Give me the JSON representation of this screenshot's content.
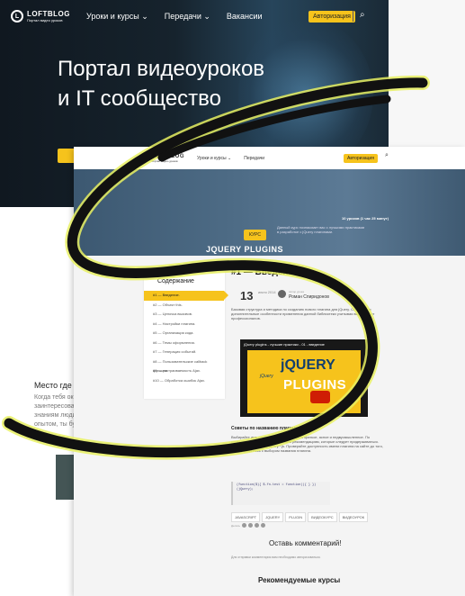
{
  "back": {
    "logo": {
      "name": "LOFTBLOG",
      "tagline": "Портал видео уроков",
      "mark": "L"
    },
    "nav": [
      "Уроки и курсы",
      "Передачи",
      "Вакансии"
    ],
    "auth_label": "Авторизация",
    "hero_title": "Портал видеоуроков и IT сообщество",
    "side_heading": "Место где",
    "side_text": "Когда тебя ок заинтересова знаниям люди опытом, ты бу"
  },
  "front": {
    "logo": {
      "name": "LOFTBLOG",
      "tagline": "Портал видео уроков",
      "mark": "L"
    },
    "nav": [
      "Уроки и курсы",
      "Передачи"
    ],
    "auth_label": "Авторизация",
    "badge": "КУРС",
    "course_title": "JQUERY PLUGINS",
    "meta": "10 уроков (1 час 25 минут)",
    "banner_desc": "Данный курс познакомит вас с лучшими практиками в разработке с jQuery плагинами.",
    "toc_heading": "Содержание",
    "toc": [
      "#1 — Введение.",
      "#2 — Объект this.",
      "#3 — Цепочка вызовов.",
      "#4 — Настройки плагина.",
      "#5 — Организация кода.",
      "#6 — Темы оформления.",
      "#7 — Генерация событий.",
      "#8 — Пользовательские callback функции.",
      "#9 — настраиваемость Ajax.",
      "#10 — Обработка ошибок Ajax."
    ],
    "article": {
      "title": "#1 — Введение.",
      "date_day": "13",
      "date_month": "июля 2014",
      "author_label": "Автор урока",
      "author": "Роман Спиридонов",
      "intro": "Базовая структура и методика по созданию нового плагина для jQuery. Основные и дополнительные особенности применения данной библиотеки учитывая вариации от профессионалов.",
      "video_title": "jQuery plugins - лучшие практики - 01 - введение",
      "video_logo": "jQUERY",
      "video_logo2": "PLUGINS",
      "video_small": "jQuery",
      "subheading": "Советы по названию плагина",
      "body": "Выбирайте имя плагина. Имя должно быть краткое, ясное и недвусмысленное. По соглашению необходимо следовать рекомендациям, которые следует придерживаться. Используйте префикс jquery.*.js. Проверяйте доступность имени плагина на сайте до того, как определитесь с выбором названия плагина.",
      "code": "(function($){ $.fn.test = function(){ } })(jQuery);",
      "tags": [
        "JAVASCRIPT",
        "JQUERY",
        "PLUGIN",
        "ВИДЕОКУРС",
        "ВИДЕОУРОК"
      ],
      "share_label": "Делись",
      "comments_heading": "Оставь комментарий!",
      "comments_note": "Для отправки комментария вам необходимо авторизоваться.",
      "recommended": "Рекомендуемые курсы"
    }
  },
  "colors": {
    "accent": "#f6c31c",
    "hero": "#16232d",
    "banner": "#4d6b85",
    "loop_fill": "#111111",
    "loop_glow": "#e8f060"
  }
}
